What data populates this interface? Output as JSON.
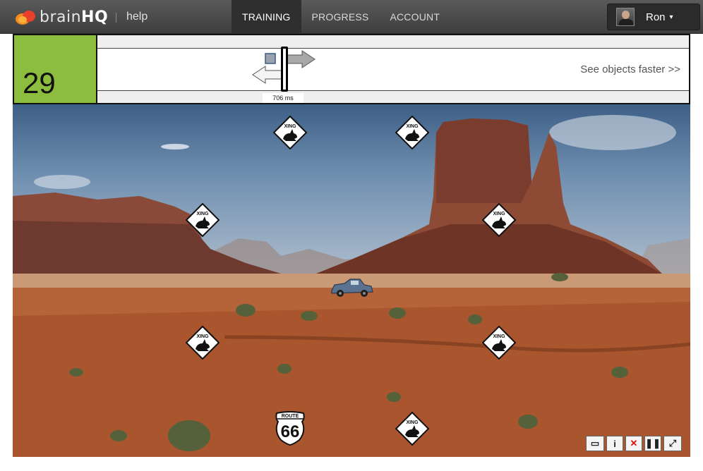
{
  "header": {
    "brand_left": "brain",
    "brand_right": "HQ",
    "help_label": "help",
    "nav": [
      {
        "label": "TRAINING",
        "active": true
      },
      {
        "label": "PROGRESS",
        "active": false
      },
      {
        "label": "ACCOUNT",
        "active": false
      }
    ],
    "user": {
      "name": "Ron",
      "caret": "▾"
    }
  },
  "game": {
    "score": "29",
    "speed_label": "706 ms",
    "hint": "See objects faster >>",
    "score_color": "#8cbd3e",
    "signs": [
      {
        "id": "xing-1",
        "label": "XING"
      },
      {
        "id": "xing-2",
        "label": "XING"
      },
      {
        "id": "xing-3",
        "label": "XING"
      },
      {
        "id": "xing-4",
        "label": "XING"
      },
      {
        "id": "xing-5",
        "label": "XING"
      },
      {
        "id": "xing-6",
        "label": "XING"
      },
      {
        "id": "xing-7",
        "label": "XING"
      }
    ],
    "route_sign": {
      "top": "ROUTE",
      "number": "66"
    },
    "controls": {
      "window": "▭",
      "info": "i",
      "close": "✕",
      "pause": "❚❚",
      "fullscreen": "⤢"
    }
  }
}
